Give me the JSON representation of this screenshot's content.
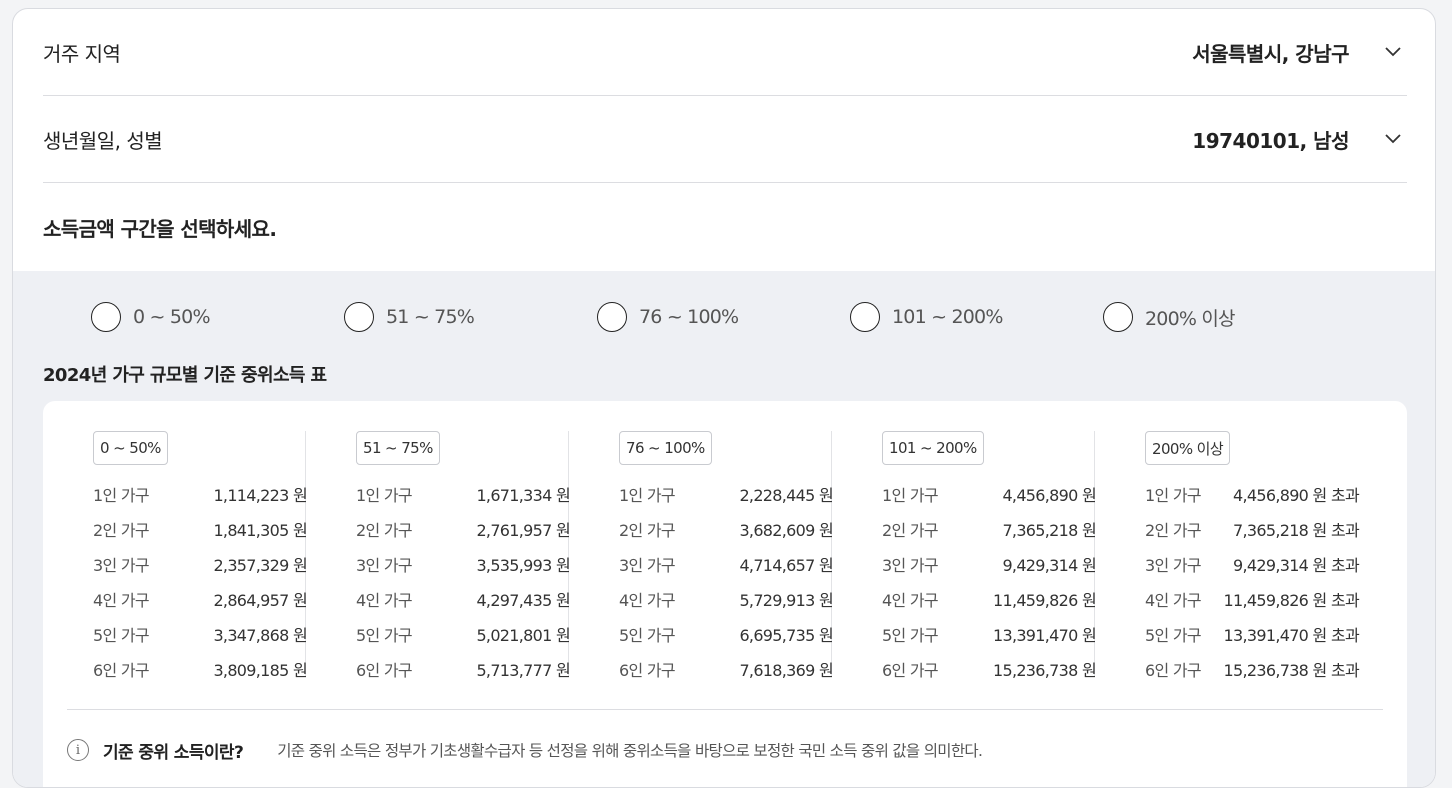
{
  "residence": {
    "label": "거주 지역",
    "value": "서울특별시, 강남구"
  },
  "birth": {
    "label": "생년월일, 성별",
    "value": "19740101, 남성"
  },
  "prompt": "소득금액 구간을 선택하세요.",
  "options": [
    "0 ~ 50%",
    "51 ~ 75%",
    "76 ~ 100%",
    "101 ~ 200%",
    "200% 이상"
  ],
  "table_title": "2024년 가구 규모별 기준 중위소득 표",
  "columns": [
    {
      "badge": "0 ~ 50%",
      "rows": [
        {
          "size": "1인 가구",
          "amount": "1,114,223 원"
        },
        {
          "size": "2인 가구",
          "amount": "1,841,305 원"
        },
        {
          "size": "3인 가구",
          "amount": "2,357,329 원"
        },
        {
          "size": "4인 가구",
          "amount": "2,864,957 원"
        },
        {
          "size": "5인 가구",
          "amount": "3,347,868 원"
        },
        {
          "size": "6인 가구",
          "amount": "3,809,185 원"
        }
      ]
    },
    {
      "badge": "51 ~ 75%",
      "rows": [
        {
          "size": "1인 가구",
          "amount": "1,671,334 원"
        },
        {
          "size": "2인 가구",
          "amount": "2,761,957 원"
        },
        {
          "size": "3인 가구",
          "amount": "3,535,993 원"
        },
        {
          "size": "4인 가구",
          "amount": "4,297,435 원"
        },
        {
          "size": "5인 가구",
          "amount": "5,021,801 원"
        },
        {
          "size": "6인 가구",
          "amount": "5,713,777 원"
        }
      ]
    },
    {
      "badge": "76 ~ 100%",
      "rows": [
        {
          "size": "1인 가구",
          "amount": "2,228,445 원"
        },
        {
          "size": "2인 가구",
          "amount": "3,682,609 원"
        },
        {
          "size": "3인 가구",
          "amount": "4,714,657 원"
        },
        {
          "size": "4인 가구",
          "amount": "5,729,913 원"
        },
        {
          "size": "5인 가구",
          "amount": "6,695,735 원"
        },
        {
          "size": "6인 가구",
          "amount": "7,618,369 원"
        }
      ]
    },
    {
      "badge": "101 ~ 200%",
      "rows": [
        {
          "size": "1인 가구",
          "amount": "4,456,890 원"
        },
        {
          "size": "2인 가구",
          "amount": "7,365,218 원"
        },
        {
          "size": "3인 가구",
          "amount": "9,429,314 원"
        },
        {
          "size": "4인 가구",
          "amount": "11,459,826 원"
        },
        {
          "size": "5인 가구",
          "amount": "13,391,470 원"
        },
        {
          "size": "6인 가구",
          "amount": "15,236,738 원"
        }
      ]
    },
    {
      "badge": "200% 이상",
      "rows": [
        {
          "size": "1인 가구",
          "amount": "4,456,890 원 초과"
        },
        {
          "size": "2인 가구",
          "amount": "7,365,218 원 초과"
        },
        {
          "size": "3인 가구",
          "amount": "9,429,314 원 초과"
        },
        {
          "size": "4인 가구",
          "amount": "11,459,826 원 초과"
        },
        {
          "size": "5인 가구",
          "amount": "13,391,470 원 초과"
        },
        {
          "size": "6인 가구",
          "amount": "15,236,738 원 초과"
        }
      ]
    }
  ],
  "info": {
    "icon": "info-icon",
    "title": "기준 중위 소득이란?",
    "text": "기준 중위 소득은 정부가 기초생활수급자 등 선정을 위해 중위소득을 바탕으로 보정한 국민 소득 중위 값을 의미한다."
  }
}
